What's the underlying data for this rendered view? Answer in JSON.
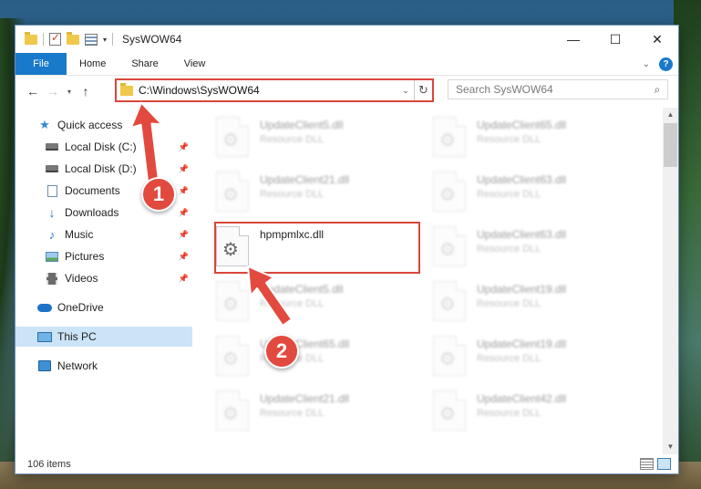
{
  "window": {
    "title": "SysWOW64",
    "controls": {
      "minimize": "—",
      "maximize": "☐",
      "close": "✕"
    }
  },
  "ribbon": {
    "tabs": [
      "File",
      "Home",
      "Share",
      "View"
    ],
    "help": "?"
  },
  "nav": {
    "address": "C:\\Windows\\SysWOW64",
    "search_placeholder": "Search SysWOW64"
  },
  "sidebar": {
    "items": [
      {
        "label": "Quick access",
        "icon": "star-icon"
      },
      {
        "label": "Local Disk (C:)",
        "icon": "drive-icon",
        "pinned": true
      },
      {
        "label": "Local Disk (D:)",
        "icon": "drive-icon",
        "pinned": true
      },
      {
        "label": "Documents",
        "icon": "documents-icon",
        "pinned": true
      },
      {
        "label": "Downloads",
        "icon": "download-icon",
        "pinned": true
      },
      {
        "label": "Music",
        "icon": "music-icon",
        "pinned": true
      },
      {
        "label": "Pictures",
        "icon": "pictures-icon",
        "pinned": true
      },
      {
        "label": "Videos",
        "icon": "videos-icon",
        "pinned": true
      },
      {
        "label": "OneDrive",
        "icon": "onedrive-icon"
      },
      {
        "label": "This PC",
        "icon": "pc-icon",
        "selected": true
      },
      {
        "label": "Network",
        "icon": "network-icon"
      }
    ]
  },
  "files": {
    "left": [
      {
        "name": "UpdateClient5.dll",
        "type": "Resource DLL"
      },
      {
        "name": "UpdateClient21.dll",
        "type": "Resource DLL"
      },
      {
        "name": "hpmpmlxc.dll",
        "type": ""
      },
      {
        "name": "UpdateClient5.dll",
        "type": "Resource DLL"
      },
      {
        "name": "UpdateClient65.dll",
        "type": "Resource DLL"
      },
      {
        "name": "UpdateClient21.dll",
        "type": "Resource DLL"
      }
    ],
    "right": [
      {
        "name": "UpdateClient65.dll",
        "type": "Resource DLL"
      },
      {
        "name": "UpdateClient63.dll",
        "type": "Resource DLL"
      },
      {
        "name": "UpdateClient63.dll",
        "type": "Resource DLL"
      },
      {
        "name": "UpdateClient19.dll",
        "type": "Resource DLL"
      },
      {
        "name": "UpdateClient19.dll",
        "type": "Resource DLL"
      },
      {
        "name": "UpdateClient42.dll",
        "type": "Resource DLL"
      }
    ]
  },
  "status": {
    "item_count": "106 items"
  },
  "callouts": {
    "step1": "1",
    "step2": "2"
  },
  "colors": {
    "accent": "#1979ca",
    "callout": "#e34a3f"
  }
}
